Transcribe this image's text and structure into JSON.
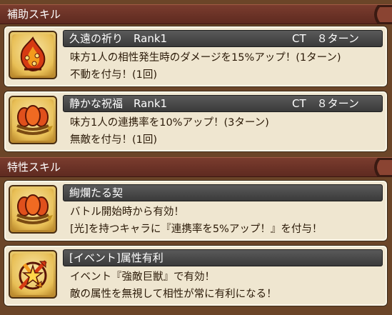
{
  "sections": {
    "support": {
      "title": "補助スキル"
    },
    "trait": {
      "title": "特性スキル"
    }
  },
  "skills": [
    {
      "name": "久遠の祈り",
      "rank": "Rank1",
      "ct": "CT　８ターン",
      "lines": [
        "味方1人の相性発生時のダメージを15%アップ！(1ターン)",
        "不動を付与！(1回)"
      ],
      "icon": "flame-charm-icon"
    },
    {
      "name": "静かな祝福",
      "rank": "Rank1",
      "ct": "CT　８ターン",
      "lines": [
        "味方1人の連携率を10%アップ！(3ターン)",
        "無敵を付与！(1回)"
      ],
      "icon": "bound-flowers-icon"
    }
  ],
  "traits": [
    {
      "name": "絢爛たる契",
      "lines": [
        "バトル開始時から有効！",
        "[光]を持つキャラに『連携率を5%アップ！』を付与！"
      ],
      "icon": "bound-flowers-icon"
    },
    {
      "name": "[イベント]属性有利",
      "lines": [
        "イベント『強敵巨獣』で有効！",
        "敵の属性を無視して相性が常に有利になる！"
      ],
      "icon": "crossed-arrows-icon"
    }
  ],
  "colors": {
    "header": "#6a3024",
    "card": "#efe6d0",
    "name_bar": "#4a4a4a",
    "icon_bg": "#e8bf56"
  }
}
